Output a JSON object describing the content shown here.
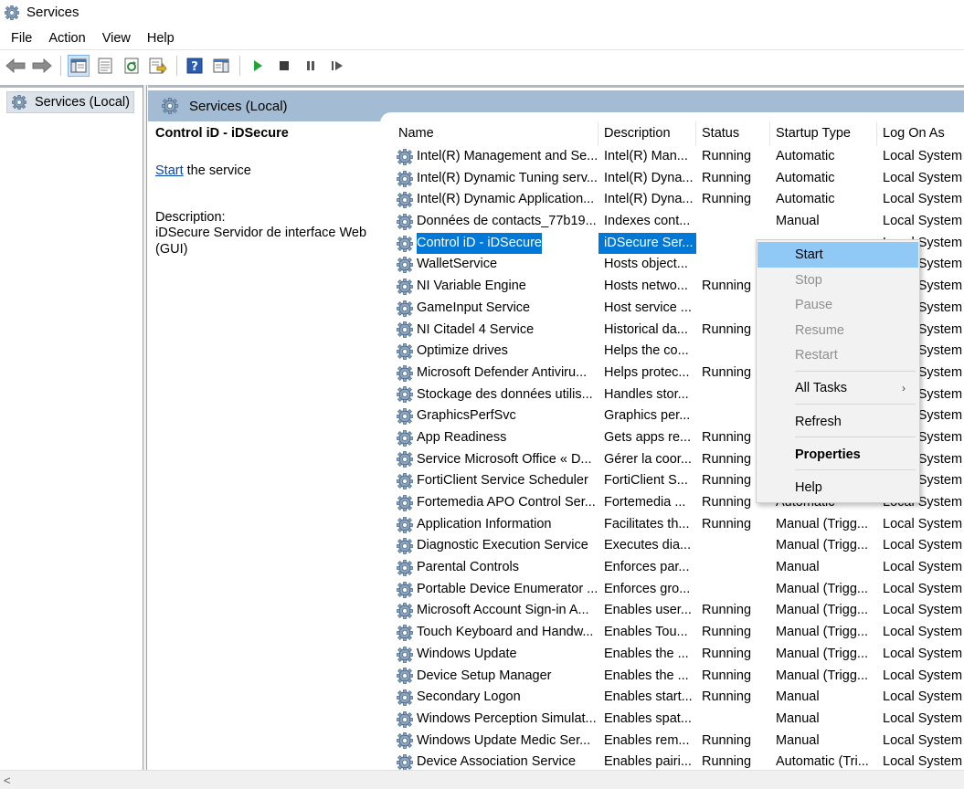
{
  "window": {
    "title": "Services"
  },
  "menubar": [
    "File",
    "Action",
    "View",
    "Help"
  ],
  "tree": {
    "root_label": "Services (Local)"
  },
  "main_header": {
    "label": "Services (Local)"
  },
  "details": {
    "service_name": "Control iD - iDSecure",
    "start_link": "Start",
    "start_suffix": " the service",
    "description_label": "Description:",
    "description_text": "iDSecure Servidor de interface Web (GUI)"
  },
  "columns": [
    "Name",
    "Description",
    "Status",
    "Startup Type",
    "Log On As"
  ],
  "rows": [
    {
      "name": "Intel(R) Management and Se...",
      "desc": "Intel(R) Man...",
      "status": "Running",
      "startup": "Automatic",
      "logon": "Local System"
    },
    {
      "name": "Intel(R) Dynamic Tuning serv...",
      "desc": "Intel(R) Dyna...",
      "status": "Running",
      "startup": "Automatic",
      "logon": "Local System"
    },
    {
      "name": "Intel(R) Dynamic Application...",
      "desc": "Intel(R) Dyna...",
      "status": "Running",
      "startup": "Automatic",
      "logon": "Local System"
    },
    {
      "name": "Données de contacts_77b19...",
      "desc": "Indexes cont...",
      "status": "",
      "startup": "Manual",
      "logon": "Local System"
    },
    {
      "name": "Control iD - iDSecure",
      "desc": "iDSecure Ser...",
      "status": "",
      "startup": "",
      "logon": "Local System",
      "selected": true
    },
    {
      "name": "WalletService",
      "desc": "Hosts object...",
      "status": "",
      "startup": "",
      "logon": "Local System"
    },
    {
      "name": "NI Variable Engine",
      "desc": "Hosts netwo...",
      "status": "Running",
      "startup": "",
      "logon": "Local System"
    },
    {
      "name": "GameInput Service",
      "desc": "Host service ...",
      "status": "",
      "startup": "",
      "logon": "Local System"
    },
    {
      "name": "NI Citadel 4 Service",
      "desc": "Historical da...",
      "status": "Running",
      "startup": "",
      "logon": "Local System"
    },
    {
      "name": "Optimize drives",
      "desc": "Helps the co...",
      "status": "",
      "startup": "",
      "logon": "Local System"
    },
    {
      "name": "Microsoft Defender Antiviru...",
      "desc": "Helps protec...",
      "status": "Running",
      "startup": "",
      "logon": "Local System"
    },
    {
      "name": "Stockage des données utilis...",
      "desc": "Handles stor...",
      "status": "",
      "startup": "",
      "logon": "Local System"
    },
    {
      "name": "GraphicsPerfSvc",
      "desc": "Graphics per...",
      "status": "",
      "startup": "",
      "logon": "Local System"
    },
    {
      "name": "App Readiness",
      "desc": "Gets apps re...",
      "status": "Running",
      "startup": "",
      "logon": "Local System"
    },
    {
      "name": "Service Microsoft Office « D...",
      "desc": "Gérer la coor...",
      "status": "Running",
      "startup": "",
      "logon": "Local System"
    },
    {
      "name": "FortiClient Service Scheduler",
      "desc": "FortiClient S...",
      "status": "Running",
      "startup": "",
      "logon": "Local System"
    },
    {
      "name": "Fortemedia APO Control Ser...",
      "desc": "Fortemedia ...",
      "status": "Running",
      "startup": "Automatic",
      "logon": "Local System"
    },
    {
      "name": "Application Information",
      "desc": "Facilitates th...",
      "status": "Running",
      "startup": "Manual (Trigg...",
      "logon": "Local System"
    },
    {
      "name": "Diagnostic Execution Service",
      "desc": "Executes dia...",
      "status": "",
      "startup": "Manual (Trigg...",
      "logon": "Local System"
    },
    {
      "name": "Parental Controls",
      "desc": "Enforces par...",
      "status": "",
      "startup": "Manual",
      "logon": "Local System"
    },
    {
      "name": "Portable Device Enumerator ...",
      "desc": "Enforces gro...",
      "status": "",
      "startup": "Manual (Trigg...",
      "logon": "Local System"
    },
    {
      "name": "Microsoft Account Sign-in A...",
      "desc": "Enables user...",
      "status": "Running",
      "startup": "Manual (Trigg...",
      "logon": "Local System"
    },
    {
      "name": "Touch Keyboard and Handw...",
      "desc": "Enables Tou...",
      "status": "Running",
      "startup": "Manual (Trigg...",
      "logon": "Local System"
    },
    {
      "name": "Windows Update",
      "desc": "Enables the ...",
      "status": "Running",
      "startup": "Manual (Trigg...",
      "logon": "Local System"
    },
    {
      "name": "Device Setup Manager",
      "desc": "Enables the ...",
      "status": "Running",
      "startup": "Manual (Trigg...",
      "logon": "Local System"
    },
    {
      "name": "Secondary Logon",
      "desc": "Enables start...",
      "status": "Running",
      "startup": "Manual",
      "logon": "Local System"
    },
    {
      "name": "Windows Perception Simulat...",
      "desc": "Enables spat...",
      "status": "",
      "startup": "Manual",
      "logon": "Local System"
    },
    {
      "name": "Windows Update Medic Ser...",
      "desc": "Enables rem...",
      "status": "Running",
      "startup": "Manual",
      "logon": "Local System"
    },
    {
      "name": "Device Association Service",
      "desc": "Enables pairi...",
      "status": "Running",
      "startup": "Automatic (Tri...",
      "logon": "Local System"
    }
  ],
  "context_menu": {
    "start": "Start",
    "stop": "Stop",
    "pause": "Pause",
    "resume": "Resume",
    "restart": "Restart",
    "all_tasks": "All Tasks",
    "refresh": "Refresh",
    "properties": "Properties",
    "help": "Help"
  },
  "colors": {
    "selection": "#0078d7",
    "header_band": "#a4bcd3",
    "menu_highlight": "#90c8f6"
  }
}
